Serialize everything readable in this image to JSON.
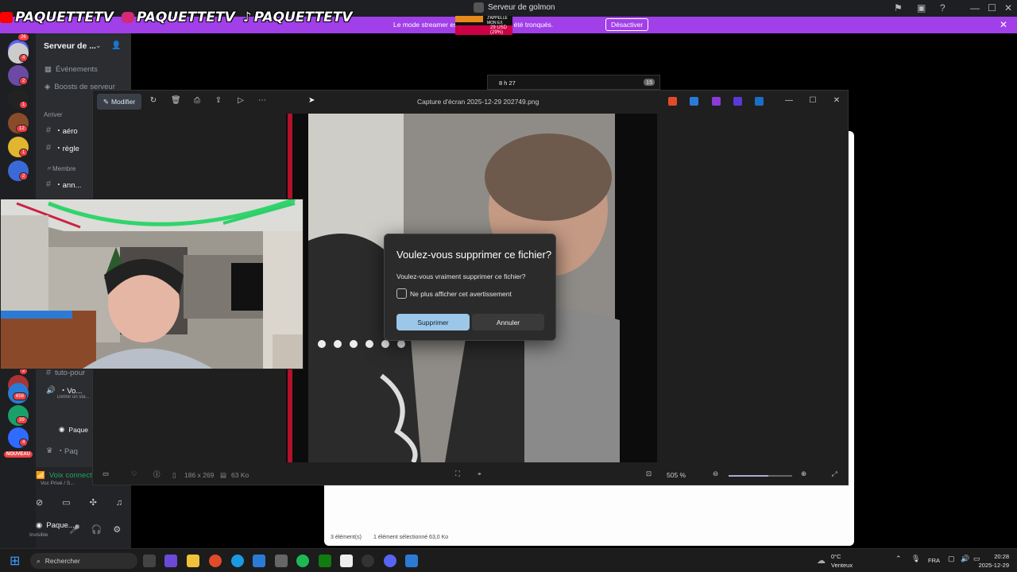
{
  "overlay": {
    "youtube": "PAQUETTETV",
    "instagram": "PAQUETTETV",
    "tiktok": "PAQUETTETV"
  },
  "titlebar": {
    "server_name": "Serveur de golmon",
    "ticker_line1": "J'APPELLE MON EX",
    "ticker_line2": "29 USD (29%)",
    "window_min": "—",
    "window_max": "☐",
    "window_close": "✕"
  },
  "streamer_banner": {
    "message": "Le mode streamer est activé. Les ... ont été tronqués.",
    "button": "Désactiver",
    "close": "✕"
  },
  "rail": {
    "badges": [
      "26",
      "4",
      "2",
      "1",
      "12",
      "1",
      "2",
      "2",
      "658",
      "39",
      "4"
    ],
    "new_label": "NOUVEAU"
  },
  "sidebar": {
    "server_title": "Serveur de ...",
    "events": "Événements",
    "boosts": "Boosts de serveur",
    "category_arrive": "Arriver",
    "channel_aero": "・aéro",
    "channel_regle": "・règle",
    "category_membre": "〃Membre",
    "channel_ann": "・ann...",
    "channel_tuto": "tuto-pour",
    "voice_channel": "・Vo...",
    "voice_status": "Définir un sta...",
    "voice_user": "Paque",
    "channel_pa": "・Paq",
    "voice_connected": "Voix connectée",
    "voice_sub": "Voc Privé / S...",
    "username": "Paque...",
    "user_status": "Invisible"
  },
  "photos": {
    "edit_label": "Modifier",
    "title": "Capture d'écran 2025-12-29 202749.png",
    "dimensions": "186 x 269",
    "filesize": "63 Ko",
    "zoom": "505 %"
  },
  "phone_pill": {
    "time": "8 h 27",
    "battery": "15"
  },
  "dialog": {
    "title": "Voulez-vous supprimer ce fichier?",
    "message": "Voulez-vous vraiment supprimer ce fichier?",
    "checkbox_label": "Ne plus afficher cet avertissement",
    "confirm": "Supprimer",
    "cancel": "Annuler"
  },
  "explorer": {
    "items": "3 élément(s)",
    "selected": "1 élément sélectionné  63,0 Ko"
  },
  "taskbar": {
    "search_placeholder": "Rechercher",
    "weather_temp": "0°C",
    "weather_desc": "Venteux",
    "lang": "FRA",
    "time": "20:28",
    "date": "2025-12-29"
  },
  "colors": {
    "discord_bg": "#1e1f22",
    "sidebar_bg": "#2b2d31",
    "streamer_purple": "#a13fe8",
    "dialog_accent": "#9cc7e8"
  }
}
